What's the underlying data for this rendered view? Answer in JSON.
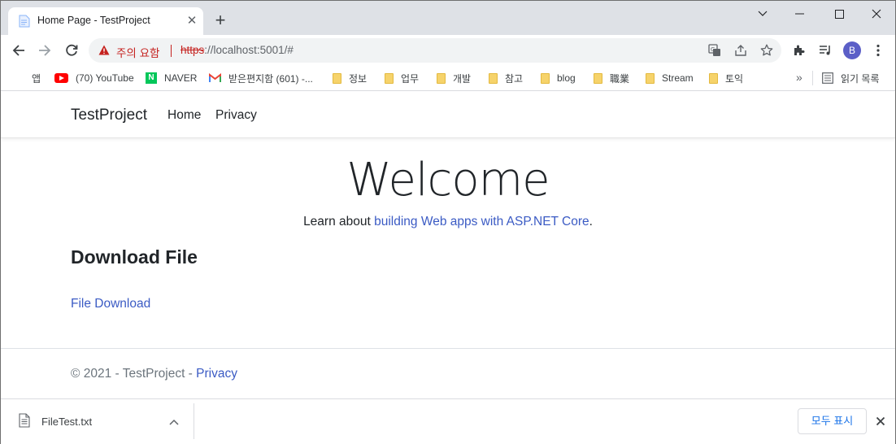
{
  "browser": {
    "tab": {
      "title": "Home Page - TestProject"
    },
    "address": {
      "warning_label": "주의 요함",
      "url_scheme": "https",
      "url_rest": "://localhost:5001/#"
    },
    "profile_initial": "B"
  },
  "bookmarks": {
    "items": [
      {
        "label": "앱",
        "icon": "apps-icon"
      },
      {
        "label": "(70) YouTube",
        "icon": "youtube-icon"
      },
      {
        "label": "NAVER",
        "icon": "naver-icon"
      },
      {
        "label": "받은편지함 (601) -...",
        "icon": "gmail-icon"
      },
      {
        "label": "정보",
        "icon": "folder-icon"
      },
      {
        "label": "업무",
        "icon": "folder-icon"
      },
      {
        "label": "개발",
        "icon": "folder-icon"
      },
      {
        "label": "참고",
        "icon": "folder-icon"
      },
      {
        "label": "blog",
        "icon": "folder-icon"
      },
      {
        "label": "職業",
        "icon": "folder-icon"
      },
      {
        "label": "Stream",
        "icon": "folder-icon"
      },
      {
        "label": "토익",
        "icon": "folder-icon"
      }
    ],
    "more": "»",
    "reading_list": "읽기 목록"
  },
  "site": {
    "brand": "TestProject",
    "nav": {
      "home": "Home",
      "privacy": "Privacy"
    },
    "welcome": "Welcome",
    "learn_prefix": "Learn about ",
    "learn_link": "building Web apps with ASP.NET Core",
    "learn_suffix": ".",
    "download_heading": "Download File",
    "file_link": "File Download",
    "footer_prefix": "© 2021 - TestProject - ",
    "footer_link": "Privacy"
  },
  "download_shelf": {
    "file_name": "FileTest.txt",
    "show_all": "모두 표시"
  },
  "colors": {
    "link": "#3b5bc4",
    "warning": "#c5221f",
    "titlebar": "#dee1e6",
    "avatar": "#5b5fc7"
  }
}
